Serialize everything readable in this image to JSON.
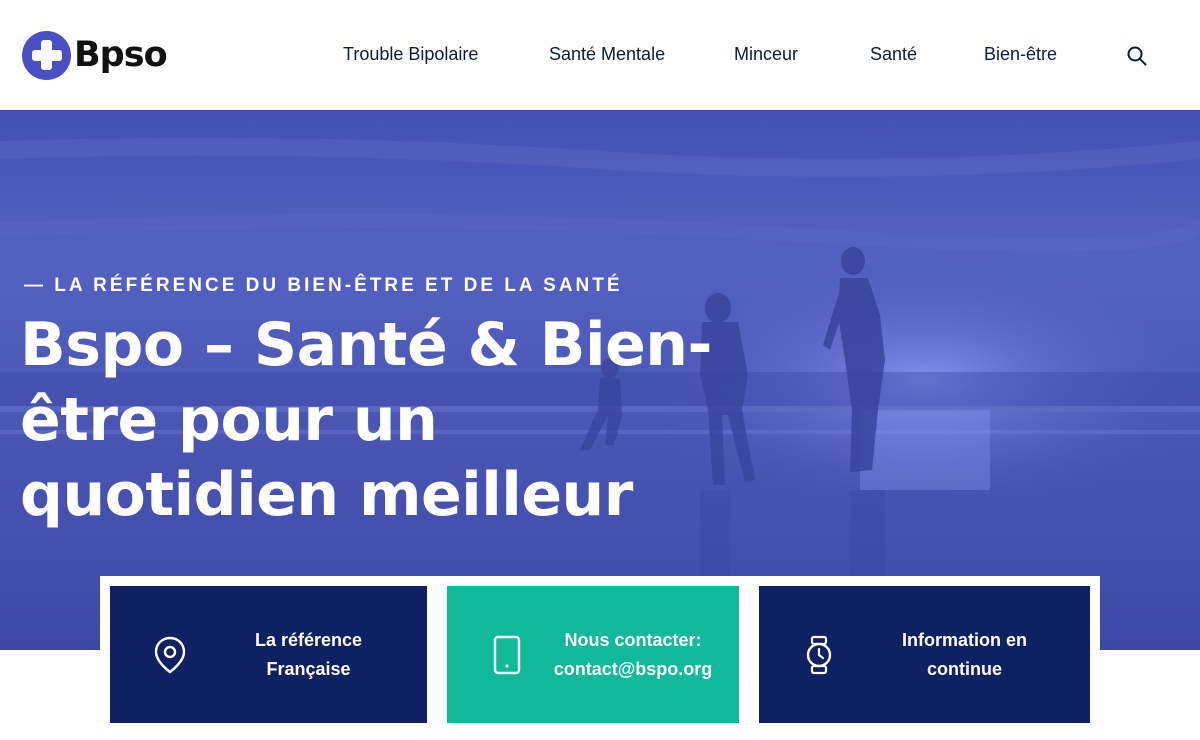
{
  "header": {
    "logo_text": "Bpso",
    "nav": [
      {
        "label": "Trouble Bipolaire"
      },
      {
        "label": "Santé Mentale"
      },
      {
        "label": "Minceur"
      },
      {
        "label": "Santé"
      },
      {
        "label": "Bien-être"
      }
    ],
    "search_icon": "search-icon"
  },
  "hero": {
    "kicker": "— LA RÉFÉRENCE DU BIEN-ÊTRE ET DE LA SANTÉ",
    "title": "Bspo – Santé & Bien-être pour un quotidien meilleur",
    "overlay_color": "#4a55b3"
  },
  "features": [
    {
      "icon": "map-pin-icon",
      "line1": "La référence",
      "line2": "Française",
      "color": "#0f2063"
    },
    {
      "icon": "tablet-icon",
      "line1": "Nous contacter:",
      "line2": "contact@bspo.org",
      "color": "#10b99a"
    },
    {
      "icon": "watch-icon",
      "line1": "Information en",
      "line2": "continue",
      "color": "#0f2063"
    }
  ],
  "colors": {
    "brand": "#4A4FC4",
    "nav_text": "#0f1b3d",
    "navy": "#0f2063",
    "teal": "#10b99a"
  }
}
